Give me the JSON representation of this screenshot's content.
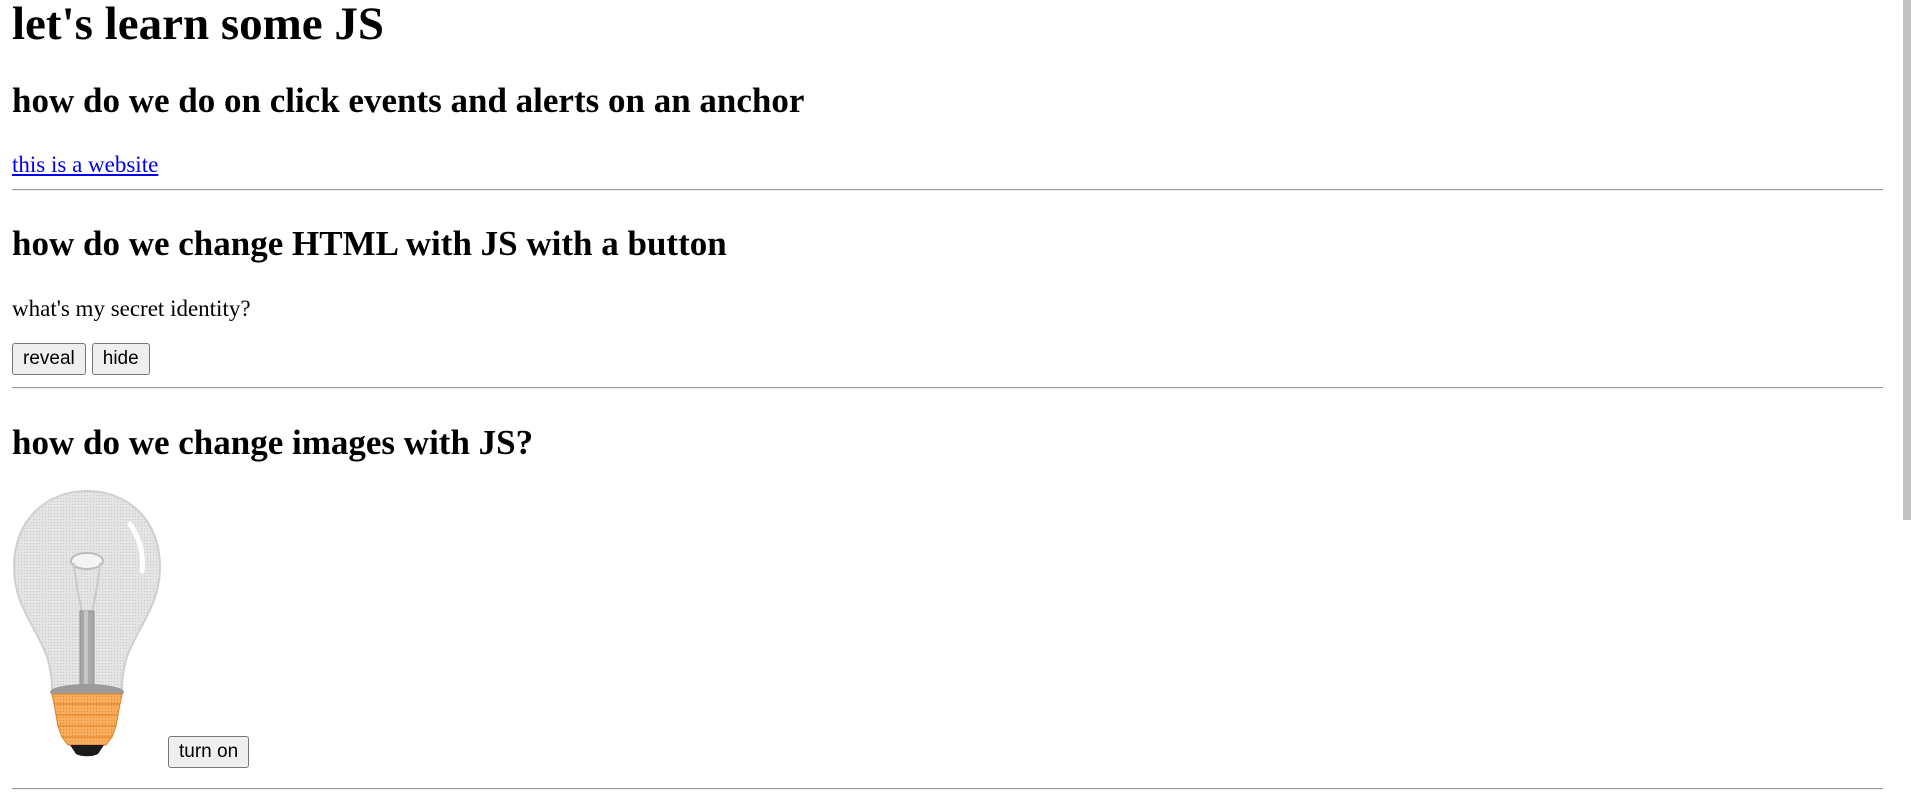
{
  "page": {
    "title": "let's learn some JS"
  },
  "section_anchor": {
    "heading": "how do we do on click events and alerts on an anchor",
    "link_text": "this is a website"
  },
  "section_html": {
    "heading": "how do we change HTML with JS with a button",
    "paragraph": "what's my secret identity?",
    "reveal_label": "reveal",
    "hide_label": "hide"
  },
  "section_images": {
    "heading": "how do we change images with JS?",
    "image_icon": "lightbulb-off-icon",
    "turn_on_label": "turn on"
  },
  "colors": {
    "link": "#0000ee",
    "bulb_base": "#f7a04b"
  }
}
